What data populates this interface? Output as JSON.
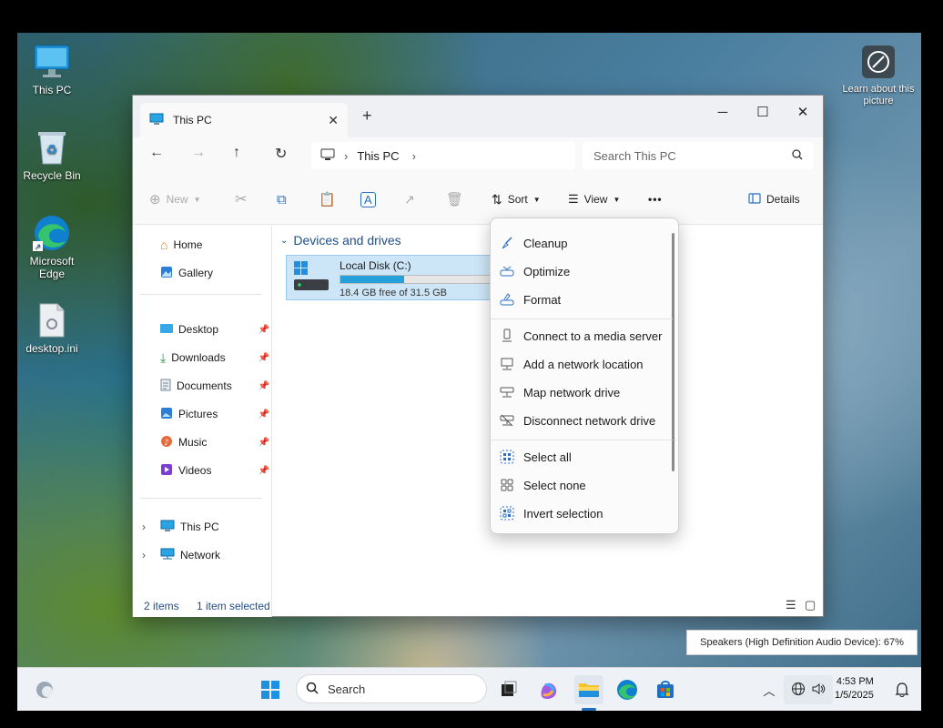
{
  "desktop": {
    "icons": [
      {
        "label": "This PC"
      },
      {
        "label": "Recycle Bin"
      },
      {
        "label": "Microsoft Edge"
      },
      {
        "label": "desktop.ini"
      }
    ],
    "learn_about": "Learn about this picture"
  },
  "window": {
    "tab_title": "This PC",
    "breadcrumb": "This PC",
    "search_placeholder": "Search This PC",
    "toolbar": {
      "new": "New",
      "sort": "Sort",
      "view": "View",
      "more": "•••",
      "details": "Details"
    },
    "sidebar": {
      "quick": [
        {
          "label": "Home"
        },
        {
          "label": "Gallery"
        }
      ],
      "pinned": [
        {
          "label": "Desktop"
        },
        {
          "label": "Downloads"
        },
        {
          "label": "Documents"
        },
        {
          "label": "Pictures"
        },
        {
          "label": "Music"
        },
        {
          "label": "Videos"
        }
      ],
      "tree": [
        {
          "label": "This PC"
        },
        {
          "label": "Network"
        }
      ]
    },
    "group_title": "Devices and drives",
    "drive": {
      "name": "Local Disk (C:)",
      "free_text": "18.4 GB free of 31.5 GB",
      "used_fraction": 0.416
    },
    "status": {
      "items": "2 items",
      "selected": "1 item selected"
    }
  },
  "menu": {
    "group1": [
      {
        "label": "Cleanup",
        "icon": "broom-icon"
      },
      {
        "label": "Optimize",
        "icon": "optimize-icon"
      },
      {
        "label": "Format",
        "icon": "format-icon"
      }
    ],
    "group2": [
      {
        "label": "Connect to a media server",
        "icon": "media-server-icon"
      },
      {
        "label": "Add a network location",
        "icon": "network-location-icon"
      },
      {
        "label": "Map network drive",
        "icon": "map-drive-icon"
      },
      {
        "label": "Disconnect network drive",
        "icon": "disconnect-drive-icon"
      }
    ],
    "group3": [
      {
        "label": "Select all",
        "icon": "select-all-icon"
      },
      {
        "label": "Select none",
        "icon": "select-none-icon"
      },
      {
        "label": "Invert selection",
        "icon": "invert-selection-icon"
      }
    ]
  },
  "tooltip": "Speakers (High Definition Audio Device): 67%",
  "taskbar": {
    "search": "Search",
    "time": "4:53 PM",
    "date": "1/5/2025"
  }
}
